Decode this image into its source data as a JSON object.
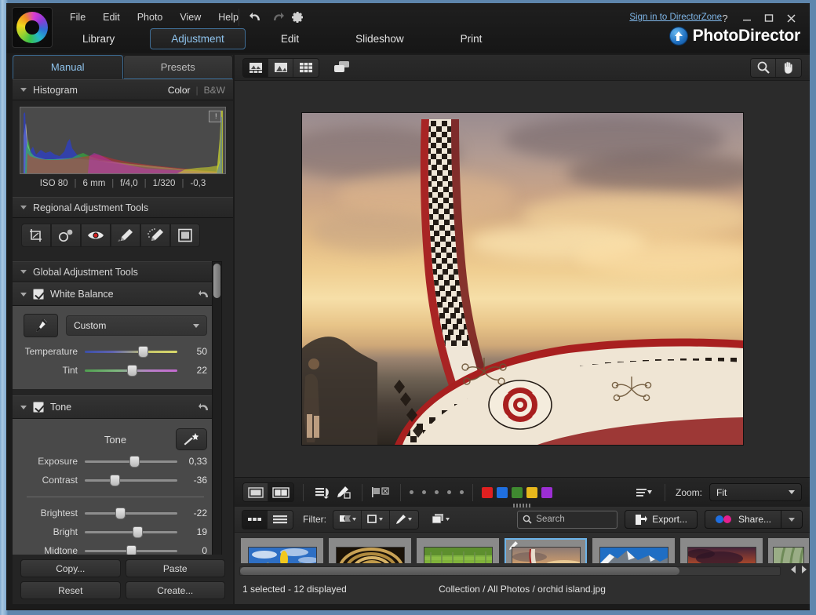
{
  "window": {
    "signin_label": "Sign in to DirectorZone",
    "help_btn": "?",
    "minimize_btn": "—",
    "maximize_btn": "❐",
    "close_btn": "✕",
    "brand_name": "PhotoDirector"
  },
  "menu": {
    "items": [
      {
        "label": "File"
      },
      {
        "label": "Edit"
      },
      {
        "label": "Photo"
      },
      {
        "label": "View"
      },
      {
        "label": "Help"
      }
    ],
    "tools": [
      "undo-icon",
      "redo-icon",
      "settings-gear-icon"
    ]
  },
  "nav_tabs": [
    {
      "label": "Library",
      "active": false
    },
    {
      "label": "Adjustment",
      "active": true
    },
    {
      "label": "Edit",
      "active": false
    },
    {
      "label": "Slideshow",
      "active": false
    },
    {
      "label": "Print",
      "active": false
    }
  ],
  "left_panel": {
    "tabs": [
      {
        "label": "Manual",
        "active": true
      },
      {
        "label": "Presets",
        "active": false
      }
    ],
    "histogram": {
      "title": "Histogram",
      "mode_color": "Color",
      "mode_separator": "|",
      "mode_bw": "B&W",
      "exif": {
        "iso": "ISO 80",
        "focal": "6 mm",
        "aperture": "f/4,0",
        "shutter": "1/320",
        "ev": "-0,3"
      }
    },
    "regional": {
      "title": "Regional Adjustment Tools",
      "tools": [
        {
          "name": "crop-rotate-icon"
        },
        {
          "name": "spot-removal-icon"
        },
        {
          "name": "red-eye-removal-icon"
        },
        {
          "name": "adjustment-brush-icon"
        },
        {
          "name": "selection-brush-icon"
        },
        {
          "name": "gradient-mask-icon"
        }
      ]
    },
    "global_title": "Global Adjustment Tools",
    "white_balance": {
      "title": "White Balance",
      "preset_value": "Custom",
      "sliders": [
        {
          "label": "Temperature",
          "value": "50",
          "pos": 62
        },
        {
          "label": "Tint",
          "value": "22",
          "pos": 50
        }
      ]
    },
    "tone": {
      "title": "Tone",
      "subtitle": "Tone",
      "sliders": [
        {
          "label": "Exposure",
          "value": "0,33",
          "pos": 52
        },
        {
          "label": "Contrast",
          "value": "-36",
          "pos": 31
        },
        {
          "label": "Brightest",
          "value": "-22",
          "pos": 37
        },
        {
          "label": "Bright",
          "value": "19",
          "pos": 56
        },
        {
          "label": "Midtone",
          "value": "0",
          "pos": 49
        }
      ]
    },
    "buttons": [
      {
        "label": "Copy..."
      },
      {
        "label": "Paste"
      },
      {
        "label": "Reset"
      },
      {
        "label": "Create..."
      }
    ]
  },
  "viewer": {
    "top_modes": [
      {
        "name": "view-filmstrip-icon",
        "active": true
      },
      {
        "name": "view-single-icon",
        "active": false
      },
      {
        "name": "view-grid-icon",
        "active": false
      }
    ],
    "secondary_monitor_icon": "secondary-display-icon",
    "search_zoom_icon": "zoom-tool-icon",
    "pan_hand_icon": "pan-hand-icon",
    "bottom": {
      "compare_modes": [
        {
          "name": "single-view-icon",
          "active": false
        },
        {
          "name": "compare-view-icon",
          "active": true
        }
      ],
      "tools": [
        {
          "name": "before-after-icon"
        },
        {
          "name": "edit-marker-icon"
        },
        {
          "name": "flag-reject-icon"
        }
      ],
      "rating_dots": 5,
      "color_flags": [
        "#e02020",
        "#1f6fe0",
        "#3f8a30",
        "#e8b81c",
        "#9c2ed4"
      ],
      "sort_icon": "sort-list-icon",
      "zoom_label": "Zoom:",
      "zoom_value": "Fit"
    }
  },
  "filmstrip": {
    "view_modes": [
      {
        "name": "thumbnail-view-icon",
        "active": true
      },
      {
        "name": "list-view-icon",
        "active": false
      }
    ],
    "filter_label": "Filter:",
    "filter_buttons": [
      {
        "name": "flag-filter-icon"
      },
      {
        "name": "rating-filter-icon"
      },
      {
        "name": "edit-filter-icon"
      },
      {
        "name": "stack-filter-icon"
      }
    ],
    "search": {
      "placeholder": "Search",
      "value": "",
      "clear_icon": "clear-search-icon",
      "search_icon": "search-icon"
    },
    "export_label": "Export...",
    "share_label": "Share...",
    "thumbnails": [
      {
        "alt": "sunflower",
        "selected": false,
        "edited": false
      },
      {
        "alt": "spiral-staircase",
        "selected": false,
        "edited": false
      },
      {
        "alt": "bicycle-meadow",
        "selected": false,
        "edited": false
      },
      {
        "alt": "orchid-island-boat",
        "selected": true,
        "edited": true
      },
      {
        "alt": "mountain-lake",
        "selected": false,
        "edited": false
      },
      {
        "alt": "sunset-lake",
        "selected": false,
        "edited": false
      },
      {
        "alt": "green-leaves",
        "selected": false,
        "edited": false
      }
    ]
  },
  "status": {
    "selection": "1 selected - 12 displayed",
    "breadcrumb": "Collection / All Photos / orchid island.jpg"
  },
  "colors": {
    "accent_blue": "#6cb3e8",
    "panel_bg": "#242424",
    "group_bg": "#494949",
    "window_border": "#7fa9cf"
  }
}
